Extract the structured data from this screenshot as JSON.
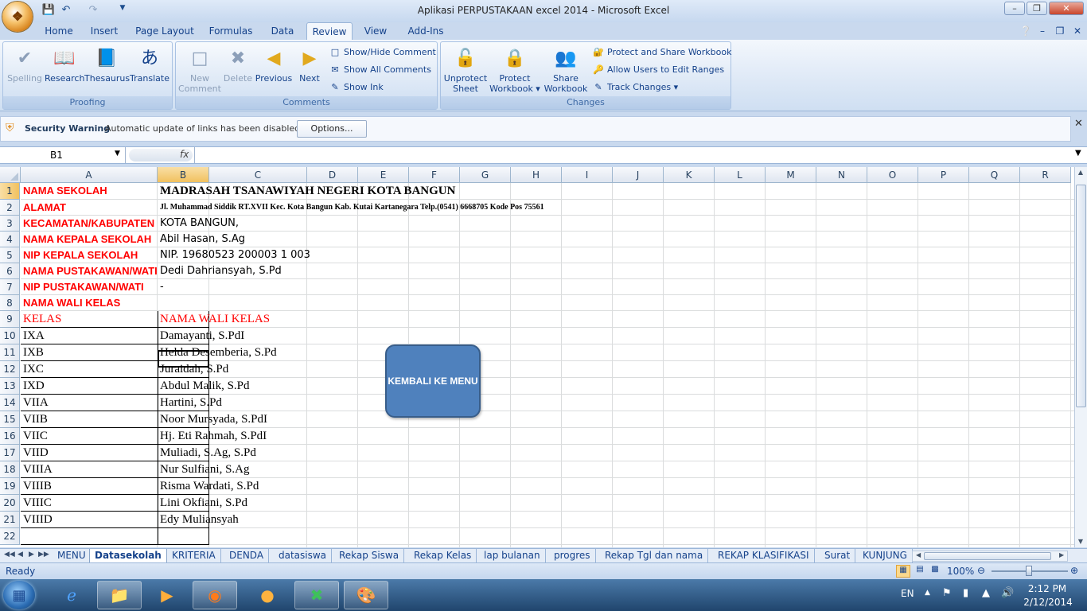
{
  "window": {
    "title": "Aplikasi PERPUSTAKAAN excel 2014  -  Microsoft Excel",
    "qat_hint": "Quick Access Toolbar"
  },
  "tabs": [
    "Home",
    "Insert",
    "Page Layout",
    "Formulas",
    "Data",
    "Review",
    "View",
    "Add-Ins"
  ],
  "active_tab": "Review",
  "ribbon": {
    "proofing": {
      "label": "Proofing",
      "buttons": [
        "Spelling",
        "Research",
        "Thesaurus",
        "Translate"
      ]
    },
    "comments": {
      "label": "Comments",
      "new": [
        "New",
        "Comment"
      ],
      "delete": "Delete",
      "previous": "Previous",
      "next": "Next",
      "show_hide": "Show/Hide Comment",
      "show_all": "Show All Comments",
      "show_ink": "Show Ink"
    },
    "changes": {
      "label": "Changes",
      "unprotect": [
        "Unprotect",
        "Sheet"
      ],
      "protect_wb": [
        "Protect",
        "Workbook"
      ],
      "share_wb": [
        "Share",
        "Workbook"
      ],
      "protect_share": "Protect and Share Workbook",
      "allow_users": "Allow Users to Edit Ranges",
      "track": "Track Changes"
    }
  },
  "security": {
    "title": "Security Warning",
    "message": "Automatic update of links has been disabled",
    "options": "Options..."
  },
  "formula_bar": {
    "name_box": "B1",
    "fx": "fx",
    "value": ""
  },
  "columns": [
    "A",
    "B",
    "C",
    "D",
    "E",
    "F",
    "G",
    "H",
    "I",
    "J",
    "K",
    "L",
    "M",
    "N",
    "O",
    "P",
    "Q",
    "R"
  ],
  "rows": [
    "1",
    "2",
    "3",
    "4",
    "5",
    "6",
    "7",
    "8",
    "9",
    "10",
    "11",
    "12",
    "13",
    "14",
    "15",
    "16",
    "17",
    "18",
    "19",
    "20",
    "21",
    "22"
  ],
  "sheet": {
    "labels": [
      "NAMA SEKOLAH",
      "ALAMAT",
      "KECAMATAN/KABUPATEN",
      "NAMA KEPALA SEKOLAH",
      "NIP KEPALA SEKOLAH",
      "NAMA PUSTAKAWAN/WATI",
      "NIP PUSTAKAWAN/WATI",
      "NAMA WALI KELAS"
    ],
    "values": [
      "MADRASAH TSANAWIYAH NEGERI KOTA BANGUN",
      "Jl. Muhammad Siddik RT.XVII Kec. Kota Bangun Kab. Kutai Kartanegara Telp.(0541) 6668705 Kode Pos 75561",
      "KOTA BANGUN,",
      "Abil Hasan, S.Ag",
      "NIP. 19680523 200003 1 003",
      "Dedi Dahriansyah, S.Pd",
      "-",
      ""
    ],
    "table_header": [
      "KELAS",
      "NAMA WALI KELAS"
    ],
    "table_rows": [
      [
        "IXA",
        "Damayanti, S.PdI"
      ],
      [
        "IXB",
        "Helda Desemberia, S.Pd"
      ],
      [
        "IXC",
        "Juraidah, S.Pd"
      ],
      [
        "IXD",
        "Abdul Malik, S.Pd"
      ],
      [
        "VIIA",
        "Hartini, S.Pd"
      ],
      [
        "VIIB",
        "Noor Mursyada, S.PdI"
      ],
      [
        "VIIC",
        "Hj. Eti Rahmah, S.PdI"
      ],
      [
        "VIID",
        "Muliadi, S.Ag, S.Pd"
      ],
      [
        "VIIIA",
        "Nur Sulfiani, S.Ag"
      ],
      [
        "VIIIB",
        "Risma Wardati, S.Pd"
      ],
      [
        "VIIIC",
        "Lini Okfiani, S.Pd"
      ],
      [
        "VIIID",
        "Edy Muliansyah"
      ]
    ]
  },
  "shape_button": "KEMBALI KE MENU",
  "sheet_tabs": [
    "MENU",
    "Datasekolah",
    "KRITERIA",
    "DENDA",
    "datasiswa",
    "Rekap Siswa",
    "Rekap Kelas",
    "lap bulanan",
    "progres",
    "Rekap Tgl dan nama",
    "REKAP KLASIFIKASI",
    "Surat",
    "KUNJUNG"
  ],
  "active_sheet": "Datasekolah",
  "status": {
    "mode": "Ready",
    "zoom": "100%"
  },
  "taskbar": {
    "lang": "EN",
    "time": "2:12 PM",
    "date": "2/12/2014"
  },
  "colors": {
    "accent": "#4f81bd",
    "label_red": "#ff0000",
    "selected_header": "#f1c15f"
  }
}
